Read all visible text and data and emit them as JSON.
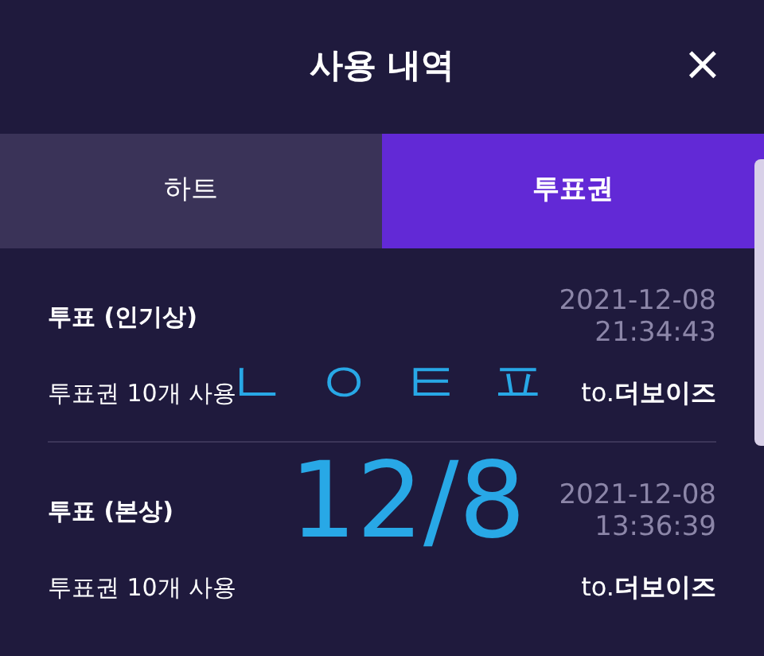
{
  "header": {
    "title": "사용 내역",
    "close": "×"
  },
  "tabs": [
    {
      "label": "하트",
      "selected": false
    },
    {
      "label": "투표권",
      "selected": true
    }
  ],
  "entries": [
    {
      "title": "투표 (인기상)",
      "date": "2021-12-08",
      "time": "21:34:43",
      "detail": "투표권 10개 사용",
      "recipient": "to.**더보이즈**"
    },
    {
      "title": "투표 (본상)",
      "date": "2021-12-08",
      "time": "13:36:39",
      "detail": "투표권 10개 사용",
      "recipient": "to.**더보이즈**"
    }
  ],
  "overlay": [
    "ㄴ ㅇ ㅌ ㅍ",
    "12/8"
  ]
}
